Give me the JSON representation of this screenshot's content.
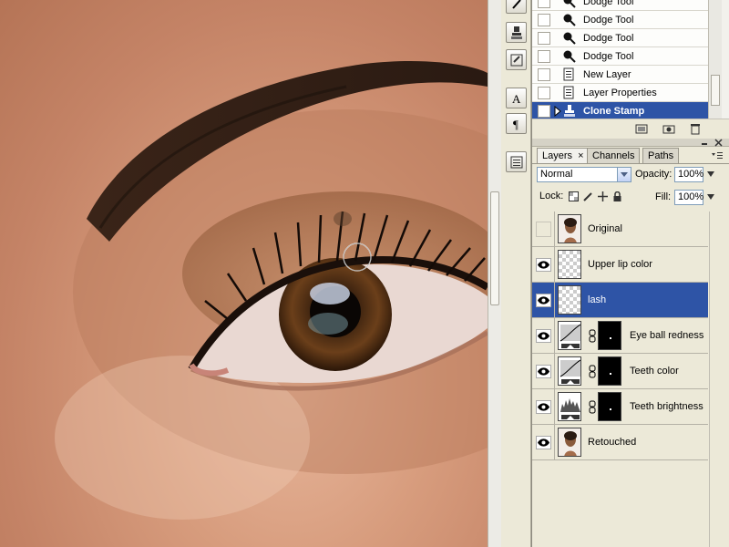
{
  "history": {
    "items": [
      {
        "label": "Dodge Tool",
        "icon": "dodge-tool-icon",
        "selected": false
      },
      {
        "label": "Dodge Tool",
        "icon": "dodge-tool-icon",
        "selected": false
      },
      {
        "label": "Dodge Tool",
        "icon": "dodge-tool-icon",
        "selected": false
      },
      {
        "label": "Dodge Tool",
        "icon": "dodge-tool-icon",
        "selected": false
      },
      {
        "label": "New Layer",
        "icon": "history-state-icon",
        "selected": false
      },
      {
        "label": "Layer Properties",
        "icon": "history-state-icon",
        "selected": false
      },
      {
        "label": "Clone Stamp",
        "icon": "clone-stamp-icon",
        "selected": true
      }
    ]
  },
  "layers_panel": {
    "tabs": [
      {
        "label": "Layers",
        "active": true
      },
      {
        "label": "Channels",
        "active": false
      },
      {
        "label": "Paths",
        "active": false
      }
    ],
    "blend_mode": "Normal",
    "opacity_label": "Opacity:",
    "opacity_value": "100%",
    "lock_label": "Lock:",
    "fill_label": "Fill:",
    "fill_value": "100%",
    "layers": [
      {
        "name": "Original",
        "visible": false,
        "thumb": "photo",
        "mask": false,
        "selected": false
      },
      {
        "name": "Upper lip color",
        "visible": true,
        "thumb": "transparent",
        "mask": false,
        "selected": false
      },
      {
        "name": "lash",
        "visible": true,
        "thumb": "transparent",
        "mask": false,
        "selected": true
      },
      {
        "name": "Eye ball redness",
        "visible": true,
        "thumb": "curves",
        "mask": true,
        "selected": false
      },
      {
        "name": "Teeth color",
        "visible": true,
        "thumb": "curves",
        "mask": true,
        "selected": false
      },
      {
        "name": "Teeth brightness",
        "visible": true,
        "thumb": "levels",
        "mask": true,
        "selected": false
      },
      {
        "name": "Retouched",
        "visible": true,
        "thumb": "photo",
        "mask": false,
        "selected": false
      }
    ]
  },
  "colors": {
    "selection": "#2e54a6",
    "panel_bg": "#ece9d8"
  }
}
